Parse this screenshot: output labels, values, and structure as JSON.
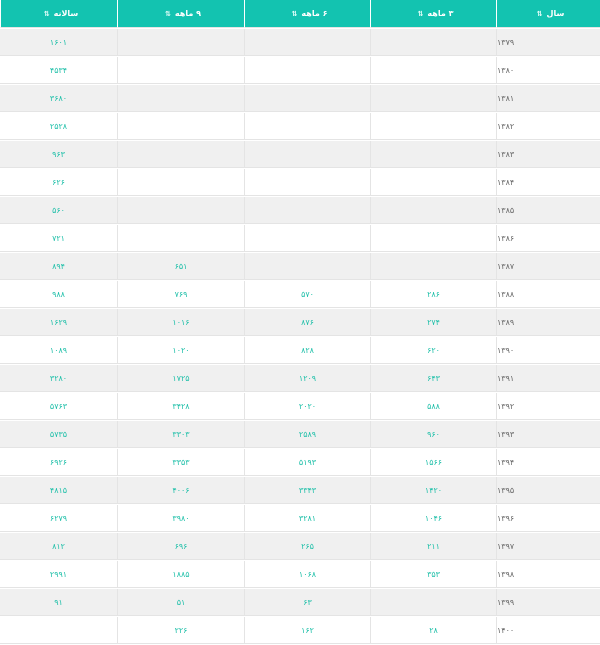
{
  "table": {
    "headers": {
      "year": "سال",
      "q3": "۳ ماهه",
      "q6": "۶ ماهه",
      "q9": "۹ ماهه",
      "annual": "سالانه"
    },
    "icons": {
      "sort": "sort-arrows-icon"
    },
    "rows": [
      {
        "year": "۱۳۷۹",
        "q3": "",
        "q6": "",
        "q9": "",
        "annual": "۱۶۰۱"
      },
      {
        "year": "۱۳۸۰",
        "q3": "",
        "q6": "",
        "q9": "",
        "annual": "۴۵۳۴"
      },
      {
        "year": "۱۳۸۱",
        "q3": "",
        "q6": "",
        "q9": "",
        "annual": "۳۶۸۰"
      },
      {
        "year": "۱۳۸۲",
        "q3": "",
        "q6": "",
        "q9": "",
        "annual": "۲۵۲۸"
      },
      {
        "year": "۱۳۸۳",
        "q3": "",
        "q6": "",
        "q9": "",
        "annual": "۹۶۳"
      },
      {
        "year": "۱۳۸۴",
        "q3": "",
        "q6": "",
        "q9": "",
        "annual": "۶۲۶"
      },
      {
        "year": "۱۳۸۵",
        "q3": "",
        "q6": "",
        "q9": "",
        "annual": "۵۶۰"
      },
      {
        "year": "۱۳۸۶",
        "q3": "",
        "q6": "",
        "q9": "",
        "annual": "۷۲۱"
      },
      {
        "year": "۱۳۸۷",
        "q3": "",
        "q6": "",
        "q9": "۶۵۱",
        "annual": "۸۹۴"
      },
      {
        "year": "۱۳۸۸",
        "q3": "۲۸۶",
        "q6": "۵۷۰",
        "q9": "۷۶۹",
        "annual": "۹۸۸"
      },
      {
        "year": "۱۳۸۹",
        "q3": "۲۷۴",
        "q6": "۸۷۶",
        "q9": "۱۰۱۶",
        "annual": "۱۶۲۹"
      },
      {
        "year": "۱۳۹۰",
        "q3": "۶۲۰",
        "q6": "۸۲۸",
        "q9": "۱۰۲۰",
        "annual": "۱۰۸۹"
      },
      {
        "year": "۱۳۹۱",
        "q3": "۶۴۳",
        "q6": "۱۲۰۹",
        "q9": "۱۷۲۵",
        "annual": "۳۲۸۰"
      },
      {
        "year": "۱۳۹۲",
        "q3": "۵۸۸",
        "q6": "۲۰۲۰",
        "q9": "۳۴۲۸",
        "annual": "۵۷۶۳"
      },
      {
        "year": "۱۳۹۳",
        "q3": "۹۶۰",
        "q6": "۲۵۸۹",
        "q9": "۳۳۰۳",
        "annual": "۵۷۳۵"
      },
      {
        "year": "۱۳۹۴",
        "q3": "۱۵۶۶",
        "q6": "۵۱۹۳",
        "q9": "۳۳۵۳",
        "annual": "۶۹۲۶"
      },
      {
        "year": "۱۳۹۵",
        "q3": "۱۴۲۰",
        "q6": "۳۳۴۳",
        "q9": "۴۰۰۶",
        "annual": "۴۸۱۵"
      },
      {
        "year": "۱۳۹۶",
        "q3": "۱۰۴۶",
        "q6": "۳۲۸۱",
        "q9": "۳۹۸۰",
        "annual": "۶۲۷۹"
      },
      {
        "year": "۱۳۹۷",
        "q3": "۲۱۱",
        "q6": "۲۶۵",
        "q9": "۶۹۶",
        "annual": "۸۱۲"
      },
      {
        "year": "۱۳۹۸",
        "q3": "۳۵۳",
        "q6": "۱۰۶۸",
        "q9": "۱۸۸۵",
        "annual": "۲۹۹۱"
      },
      {
        "year": "۱۳۹۹",
        "q3": "",
        "q6": "۶۳",
        "q9": "۵۱",
        "annual": "۹۱"
      },
      {
        "year": "۱۴۰۰",
        "q3": "۲۸",
        "q6": "۱۶۲",
        "q9": "۲۲۶",
        "annual": ""
      }
    ]
  }
}
